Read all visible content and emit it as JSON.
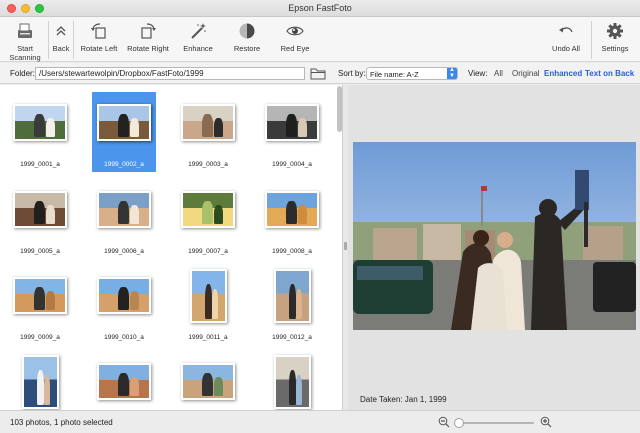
{
  "window": {
    "title": "Epson FastFoto"
  },
  "toolbar": {
    "start_scanning": "Start\nScanning",
    "back": "Back",
    "rotate_left": "Rotate Left",
    "rotate_right": "Rotate Right",
    "enhance": "Enhance",
    "restore": "Restore",
    "red_eye": "Red Eye",
    "undo_all": "Undo All",
    "settings": "Settings"
  },
  "folder": {
    "label": "Folder:",
    "path": "/Users/stewartewolpin/Dropbox/FastFoto/1999"
  },
  "sort": {
    "label": "Sort by:",
    "value": "File name: A-Z"
  },
  "view": {
    "label": "View:",
    "options": [
      "All",
      "Original",
      "Enhanced",
      "Text on Back"
    ],
    "active": [
      "Enhanced",
      "Text on Back"
    ]
  },
  "photos": [
    {
      "name": "1999_0001_a",
      "selected": false
    },
    {
      "name": "1999_0002_a",
      "selected": true
    },
    {
      "name": "1999_0003_a",
      "selected": false
    },
    {
      "name": "1999_0004_a",
      "selected": false
    },
    {
      "name": "1999_0005_a",
      "selected": false
    },
    {
      "name": "1999_0006_a",
      "selected": false
    },
    {
      "name": "1999_0007_a",
      "selected": false
    },
    {
      "name": "1999_0008_a",
      "selected": false
    },
    {
      "name": "1999_0009_a",
      "selected": false
    },
    {
      "name": "1999_0010_a",
      "selected": false
    },
    {
      "name": "1999_0011_a",
      "selected": false
    },
    {
      "name": "1999_0012_a",
      "selected": false
    },
    {
      "name": "",
      "selected": false
    },
    {
      "name": "",
      "selected": false
    },
    {
      "name": "",
      "selected": false
    },
    {
      "name": "",
      "selected": false
    }
  ],
  "preview": {
    "date_taken": "Date Taken: Jan 1, 1999"
  },
  "status": {
    "text": "103 photos, 1 photo selected",
    "zoom_fraction": 0.03
  },
  "colors": {
    "accent": "#3b87f0",
    "selection": "#4c95ec",
    "enhanced_link": "#2860d8"
  },
  "icons": {
    "start_scanning": "scanner-icon",
    "back": "chevron-up-icon",
    "rotate_left": "rotate-left-icon",
    "rotate_right": "rotate-right-icon",
    "enhance": "magic-wand-icon",
    "restore": "restore-icon",
    "red_eye": "eye-icon",
    "undo_all": "undo-icon",
    "settings": "gear-icon",
    "folder": "folder-icon",
    "zoom_out": "zoom-out-icon",
    "zoom_in": "zoom-in-icon"
  }
}
